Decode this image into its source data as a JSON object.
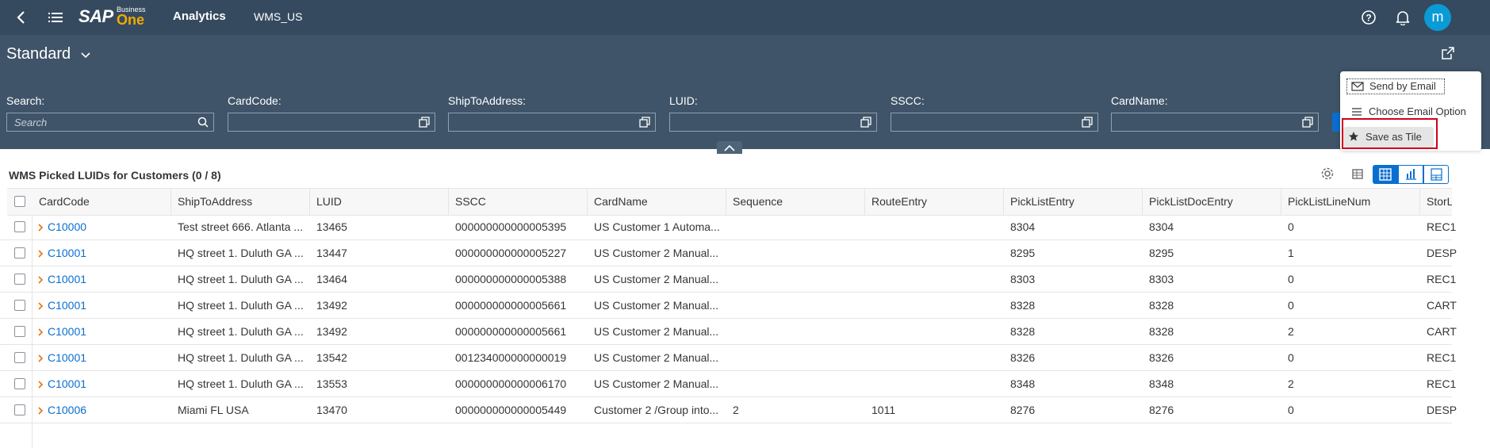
{
  "shell": {
    "brand_top": "Business",
    "brand_one": "One",
    "brand_sap": "SAP",
    "app_title": "Analytics",
    "company": "WMS_US",
    "avatar_letter": "m"
  },
  "variant": {
    "label": "Standard"
  },
  "filters": [
    {
      "label": "Search:",
      "placeholder": "Search"
    },
    {
      "label": "CardCode:",
      "placeholder": ""
    },
    {
      "label": "ShipToAddress:",
      "placeholder": ""
    },
    {
      "label": "LUID:",
      "placeholder": ""
    },
    {
      "label": "SSCC:",
      "placeholder": ""
    },
    {
      "label": "CardName:",
      "placeholder": ""
    }
  ],
  "share_menu": {
    "send_email": "Send by Email",
    "choose_email": "Choose Email Option",
    "save_tile": "Save as Tile"
  },
  "table": {
    "title": "WMS Picked LUIDs for Customers (0 / 8)",
    "columns": [
      "CardCode",
      "ShipToAddress",
      "LUID",
      "SSCC",
      "CardName",
      "Sequence",
      "RouteEntry",
      "PickListEntry",
      "PickListDocEntry",
      "PickListLineNum",
      "StorL"
    ],
    "rows": [
      [
        "C10000",
        "Test street 666. Atlanta ...",
        "13465",
        "000000000000005395",
        "US Customer 1 Automa...",
        "",
        "",
        "8304",
        "8304",
        "0",
        "REC1"
      ],
      [
        "C10001",
        "HQ street 1. Duluth GA ...",
        "13447",
        "000000000000005227",
        "US Customer 2 Manual...",
        "",
        "",
        "8295",
        "8295",
        "1",
        "DESP"
      ],
      [
        "C10001",
        "HQ street 1. Duluth GA ...",
        "13464",
        "000000000000005388",
        "US Customer 2 Manual...",
        "",
        "",
        "8303",
        "8303",
        "0",
        "REC1"
      ],
      [
        "C10001",
        "HQ street 1. Duluth GA ...",
        "13492",
        "000000000000005661",
        "US Customer 2 Manual...",
        "",
        "",
        "8328",
        "8328",
        "0",
        "CART"
      ],
      [
        "C10001",
        "HQ street 1. Duluth GA ...",
        "13492",
        "000000000000005661",
        "US Customer 2 Manual...",
        "",
        "",
        "8328",
        "8328",
        "2",
        "CART"
      ],
      [
        "C10001",
        "HQ street 1. Duluth GA ...",
        "13542",
        "001234000000000019",
        "US Customer 2 Manual...",
        "",
        "",
        "8326",
        "8326",
        "0",
        "REC1"
      ],
      [
        "C10001",
        "HQ street 1. Duluth GA ...",
        "13553",
        "000000000000006170",
        "US Customer 2 Manual...",
        "",
        "",
        "8348",
        "8348",
        "2",
        "REC1"
      ],
      [
        "C10006",
        "Miami FL USA",
        "13470",
        "000000000000005449",
        "Customer 2 /Group into...",
        "2",
        "1011",
        "8276",
        "8276",
        "0",
        "DESP"
      ]
    ]
  },
  "colors": {
    "shell": "#354a5f",
    "filterbar": "#3f5468",
    "link": "#0a6ed1",
    "highlight": "#d0021b",
    "avatar": "#0a9ad6"
  }
}
